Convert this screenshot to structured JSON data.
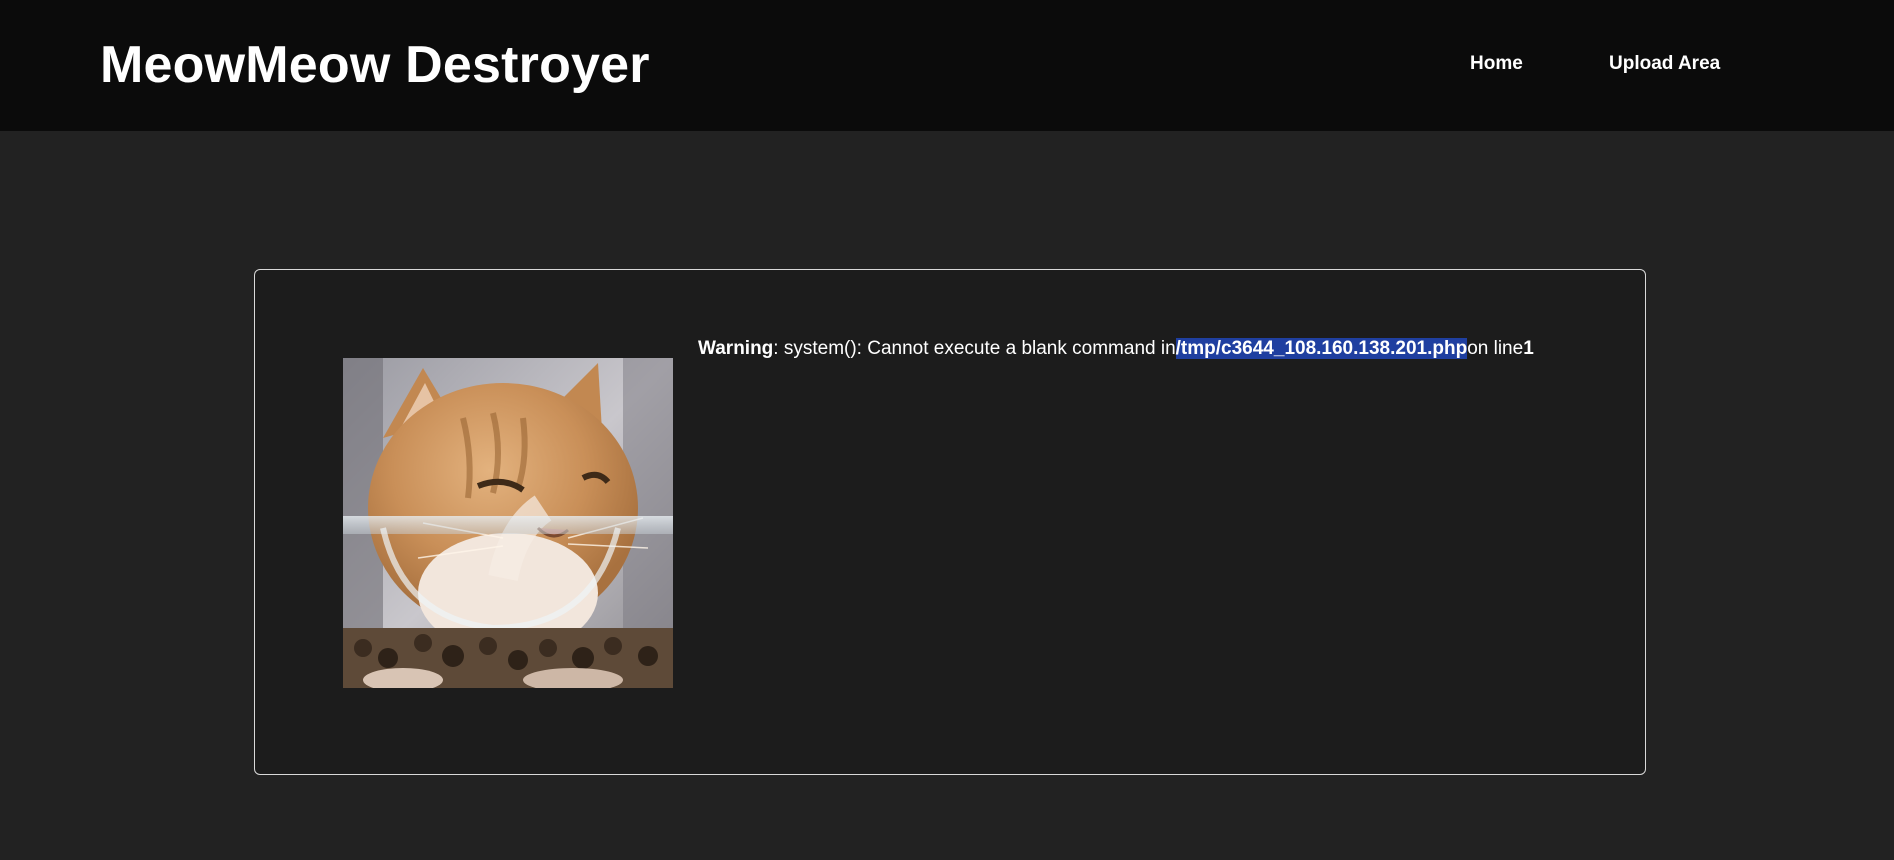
{
  "header": {
    "brand": "MeowMeow Destroyer",
    "nav": {
      "home_label": "Home",
      "upload_label": "Upload Area"
    }
  },
  "main": {
    "image": {
      "icon": "cat-photo"
    },
    "error": {
      "level": "Warning",
      "message": ": system(): Cannot execute a blank command in",
      "path": "/tmp/c3644_108.160.138.201.php",
      "suffix": "on line",
      "line": "1"
    }
  },
  "colors": {
    "header_bg": "#0b0b0b",
    "page_bg": "#222222",
    "card_bg": "#1c1c1c",
    "card_border": "#d9d9d9",
    "selection": "#1f3fa0"
  }
}
